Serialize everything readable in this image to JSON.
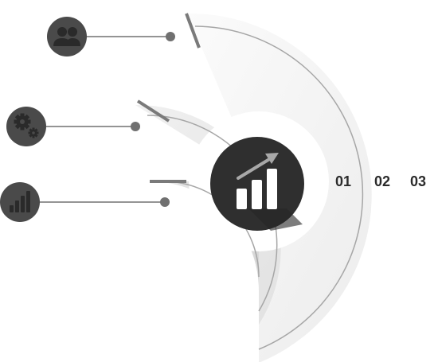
{
  "colors": {
    "ring_light": "#f4f4f4",
    "ring_mid": "#e9e9e9",
    "ring_dark": "#dcdcdc",
    "arc_line": "#9b9b9b",
    "connector": "#707070",
    "icon_circle": "#4a4a4a",
    "hub": "#2f2f2f",
    "hub_shadow": "#252525",
    "label": "#2b2b2b"
  },
  "rings": [
    {
      "label": "01",
      "icon": "chart-icon"
    },
    {
      "label": "02",
      "icon": "gear-icon"
    },
    {
      "label": "03",
      "icon": "users-icon"
    }
  ],
  "hub": {
    "icon": "growth-chart-icon"
  }
}
